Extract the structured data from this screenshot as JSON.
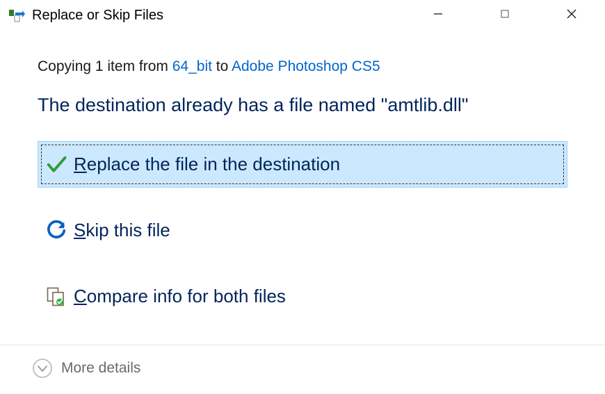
{
  "titlebar": {
    "title": "Replace or Skip Files"
  },
  "status": {
    "prefix": "Copying 1 item from ",
    "source": "64_bit",
    "mid": " to ",
    "destination": "Adobe Photoshop CS5"
  },
  "conflict_message": "The destination already has a file named \"amtlib.dll\"",
  "options": {
    "replace": {
      "accel": "R",
      "rest": "eplace the file in the destination"
    },
    "skip": {
      "accel": "S",
      "rest": "kip this file"
    },
    "compare": {
      "accel": "C",
      "rest": "ompare info for both files"
    }
  },
  "footer": {
    "more_details": "More details"
  }
}
